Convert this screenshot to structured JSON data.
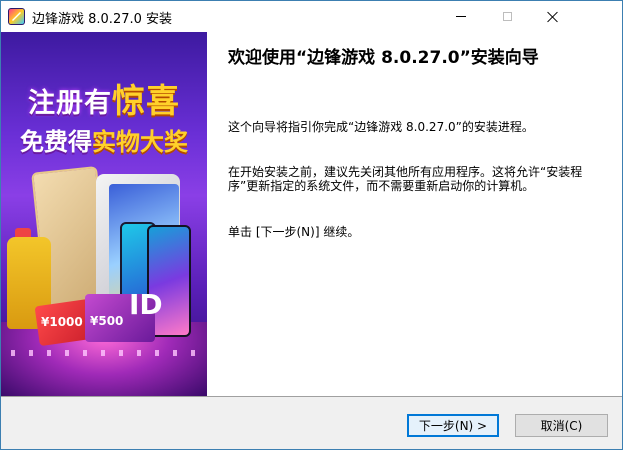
{
  "window": {
    "title": "边锋游戏 8.0.27.0 安装"
  },
  "banner": {
    "headline_plain": "注册有",
    "headline_highlight": "惊喜",
    "subline_plain": "免费得",
    "subline_highlight": "实物大奖",
    "card_left_text": "¥1000",
    "card_right_text": "¥500",
    "card_right_logo": "ID"
  },
  "content": {
    "heading": "欢迎使用“边锋游戏 8.0.27.0”安装向导",
    "paragraph1": "这个向导将指引你完成“边锋游戏 8.0.27.0”的安装进程。",
    "paragraph2": "在开始安装之前，建议先关闭其他所有应用程序。这将允许“安装程序”更新指定的系统文件，而不需要重新启动你的计算机。",
    "paragraph3": "单击 [下一步(N)] 继续。"
  },
  "buttons": {
    "next_label": "下一步(N) >",
    "cancel_label": "取消(C)"
  },
  "colors": {
    "title_border": "#3c7fb1",
    "focus_button_border": "#0078d7",
    "banner_purple": "#6a2fd6"
  }
}
